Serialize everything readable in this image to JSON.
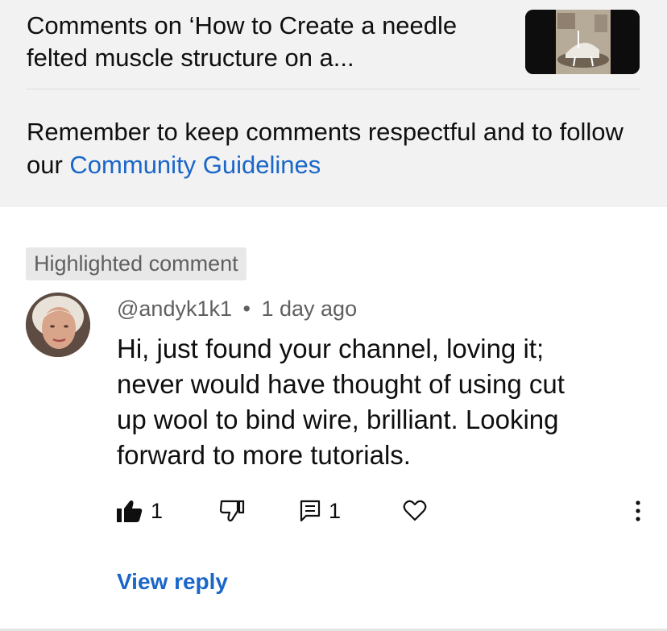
{
  "header": {
    "video_title": "Comments on ‘How to Create a needle felted muscle structure on a...",
    "thumbnail_icon": "video-thumbnail",
    "notice_text": "Remember to keep comments respectful and to follow our ",
    "guidelines_link": "Community Guidelines"
  },
  "comment": {
    "highlight_badge": "Highlighted comment",
    "author": "@andyk1k1",
    "separator": "•",
    "time": "1 day ago",
    "text": "Hi, just found your channel, loving it;\nnever would have thought of using cut\nup wool to bind wire, brilliant.  Looking\nforward to more tutorials.",
    "like_count": "1",
    "reply_count": "1",
    "view_reply_label": "View reply"
  },
  "colors": {
    "header_bg": "#f2f2f2",
    "link": "#1a66c9",
    "muted": "#606060",
    "text": "#0f0f0f"
  },
  "icons": {
    "like": "thumbs-up-filled-icon",
    "dislike": "thumbs-down-icon",
    "reply": "comment-icon",
    "heart": "heart-icon",
    "more": "more-vertical-icon"
  }
}
